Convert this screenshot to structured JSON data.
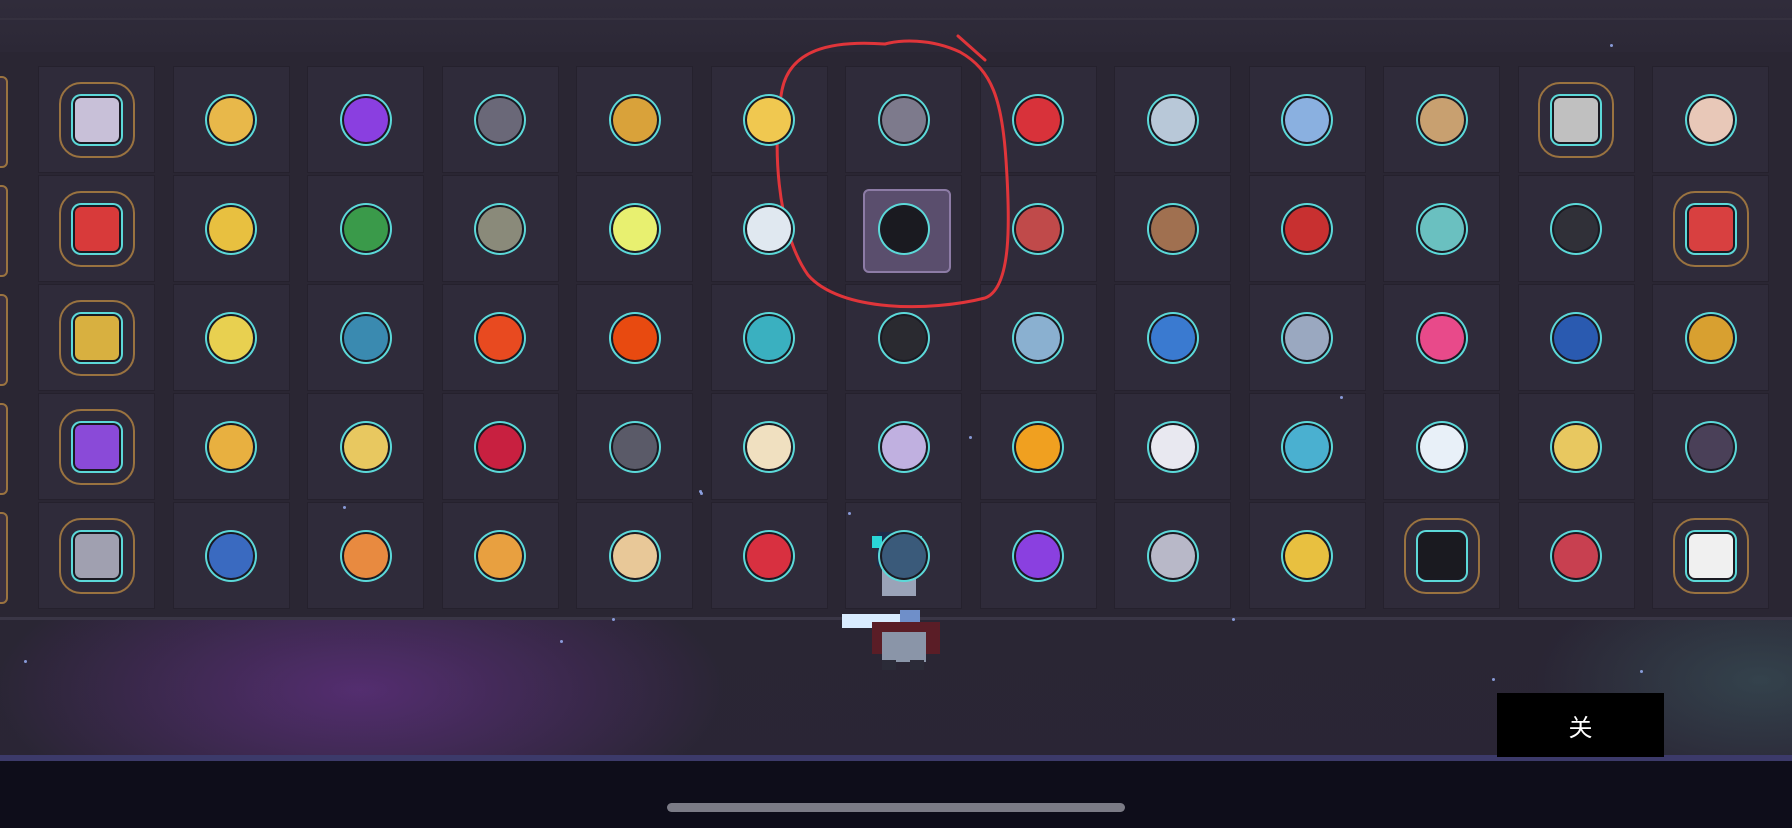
{
  "close_button": {
    "label": "关"
  },
  "rows": [
    [
      "rare",
      "",
      "",
      "",
      "",
      "",
      "",
      "",
      "",
      "",
      "",
      "rare",
      ""
    ],
    [
      "rare",
      "",
      "",
      "",
      "",
      "",
      "selected",
      "",
      "",
      "",
      "",
      "",
      "rare"
    ],
    [
      "rare",
      "",
      "",
      "",
      "",
      "",
      "",
      "",
      "",
      "",
      "",
      "",
      ""
    ],
    [
      "rare",
      "",
      "",
      "",
      "",
      "",
      "",
      "",
      "",
      "",
      "",
      "",
      ""
    ],
    [
      "rare",
      "",
      "",
      "",
      "",
      "",
      "",
      "",
      "",
      "",
      "rare",
      "",
      "rare"
    ]
  ],
  "icons": [
    [
      "cauldron-icon",
      "golden-wings-icon",
      "violet-crystal-icon",
      "dark-ring-icon",
      "sun-flower-icon",
      "triangle-eye-icon",
      "stone-coin-icon",
      "red-v-badge-icon",
      "drill-icon",
      "telescope-icon",
      "portrait-card-icon",
      "flask-icon",
      "claw-pair-icon"
    ],
    [
      "heart-shield-icon",
      "golden-spider-icon",
      "green-potion-icon",
      "pickaxe-icon",
      "green-eye-orb-icon",
      "pegasus-icon",
      "shadow-cloak-icon",
      "eagle-badge-icon",
      "coffee-cup-icon",
      "red-demon-mask-icon",
      "stone-mask-icon",
      "ammo-mag-icon",
      "red-gadget-icon"
    ],
    [
      "golden-crown-icon",
      "gold-card-icon",
      "star-medal-icon",
      "burning-heart-icon",
      "fire-eye-icon",
      "blue-fish-icon",
      "scope-rifle-icon",
      "battle-axe-icon",
      "blue-planet-icon",
      "headphones-icon",
      "pink-dart-icon",
      "police-badge-icon",
      "sheriff-medal-icon"
    ],
    [
      "purple-egg-icon",
      "golden-bird-icon",
      "gold-coin-icon",
      "ruby-gem-icon",
      "compass-icon",
      "cake-slice-icon",
      "tesla-coil-icon",
      "golden-apple-icon",
      "tower-emblem-icon",
      "shuriken-icon",
      "paper-plane-icon",
      "dice-icon",
      "dark-amulet-icon"
    ],
    [
      "spartan-helmet-icon",
      "blue-spirit-icon",
      "sad-face-icon",
      "lion-medal-icon",
      "treasure-map-icon",
      "red-cap-icon",
      "dark-knight-icon",
      "amethyst-icon",
      "cannon-icon",
      "gold-blaster-icon",
      "skull-shield-icon",
      "slingshot-icon",
      "jar-icon"
    ]
  ],
  "colors": {
    "background": "#2b2735",
    "cell": "#2f2b3a",
    "rare_frame": "#9a7340",
    "icon_glow": "#5cd9d9",
    "annotation_circle": "#e0353a",
    "selected_cell": "#5a4e6d"
  }
}
